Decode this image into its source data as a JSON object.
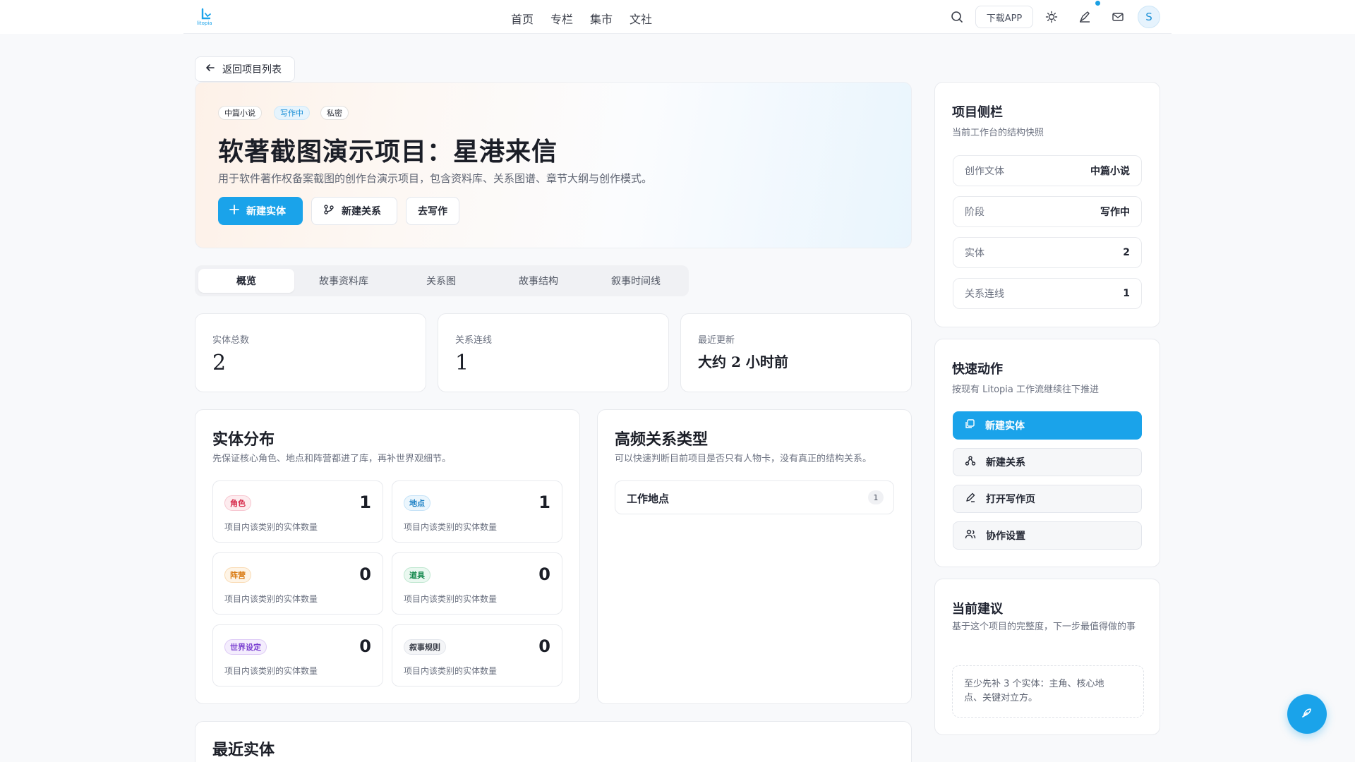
{
  "nav": {
    "logo_text": "litopia",
    "items": [
      "首页",
      "专栏",
      "集市",
      "文社"
    ],
    "download_label": "下载APP",
    "avatar_letter": "S"
  },
  "back_label": "返回项目列表",
  "hero": {
    "tags": [
      "中篇小说",
      "写作中",
      "私密"
    ],
    "title": "软著截图演示项目：星港来信",
    "subtitle": "用于软件著作权备案截图的创作台演示项目，包含资料库、关系图谱、章节大纲与创作模式。",
    "buttons": {
      "new_entity": "新建实体",
      "new_relation": "新建关系",
      "go_write": "去写作"
    }
  },
  "tabs": [
    "概览",
    "故事资料库",
    "关系图",
    "故事结构",
    "叙事时间线"
  ],
  "stats": [
    {
      "label": "实体总数",
      "value": "2"
    },
    {
      "label": "关系连线",
      "value": "1"
    },
    {
      "label": "最近更新",
      "value": "大约 2 小时前"
    }
  ],
  "distribution": {
    "title": "实体分布",
    "subtitle": "先保证核心角色、地点和阵营都进了库，再补世界观细节。",
    "items": [
      {
        "label": "角色",
        "count": "1",
        "desc": "项目内该类别的实体数量"
      },
      {
        "label": "地点",
        "count": "1",
        "desc": "项目内该类别的实体数量"
      },
      {
        "label": "阵营",
        "count": "0",
        "desc": "项目内该类别的实体数量"
      },
      {
        "label": "道具",
        "count": "0",
        "desc": "项目内该类别的实体数量"
      },
      {
        "label": "世界设定",
        "count": "0",
        "desc": "项目内该类别的实体数量"
      },
      {
        "label": "叙事规则",
        "count": "0",
        "desc": "项目内该类别的实体数量"
      }
    ]
  },
  "relations": {
    "title": "高频关系类型",
    "subtitle": "可以快速判断目前项目是否只有人物卡，没有真正的结构关系。",
    "items": [
      {
        "label": "工作地点",
        "count": "1"
      }
    ]
  },
  "recent": {
    "title": "最近实体"
  },
  "sidebar": {
    "title": "项目侧栏",
    "subtitle": "当前工作台的结构快照",
    "rows": [
      {
        "k": "创作文体",
        "v": "中篇小说"
      },
      {
        "k": "阶段",
        "v": "写作中"
      },
      {
        "k": "实体",
        "v": "2"
      },
      {
        "k": "关系连线",
        "v": "1"
      }
    ]
  },
  "quick": {
    "title": "快速动作",
    "subtitle": "按现有 Litopia 工作流继续往下推进",
    "actions": [
      "新建实体",
      "新建关系",
      "打开写作页",
      "协作设置"
    ]
  },
  "suggest": {
    "title": "当前建议",
    "subtitle": "基于这个项目的完整度，下一步最值得做的事",
    "text": "至少先补 3 个实体：主角、核心地点、关键对立方。"
  },
  "colors": {
    "accent": "#1aa3ea"
  }
}
